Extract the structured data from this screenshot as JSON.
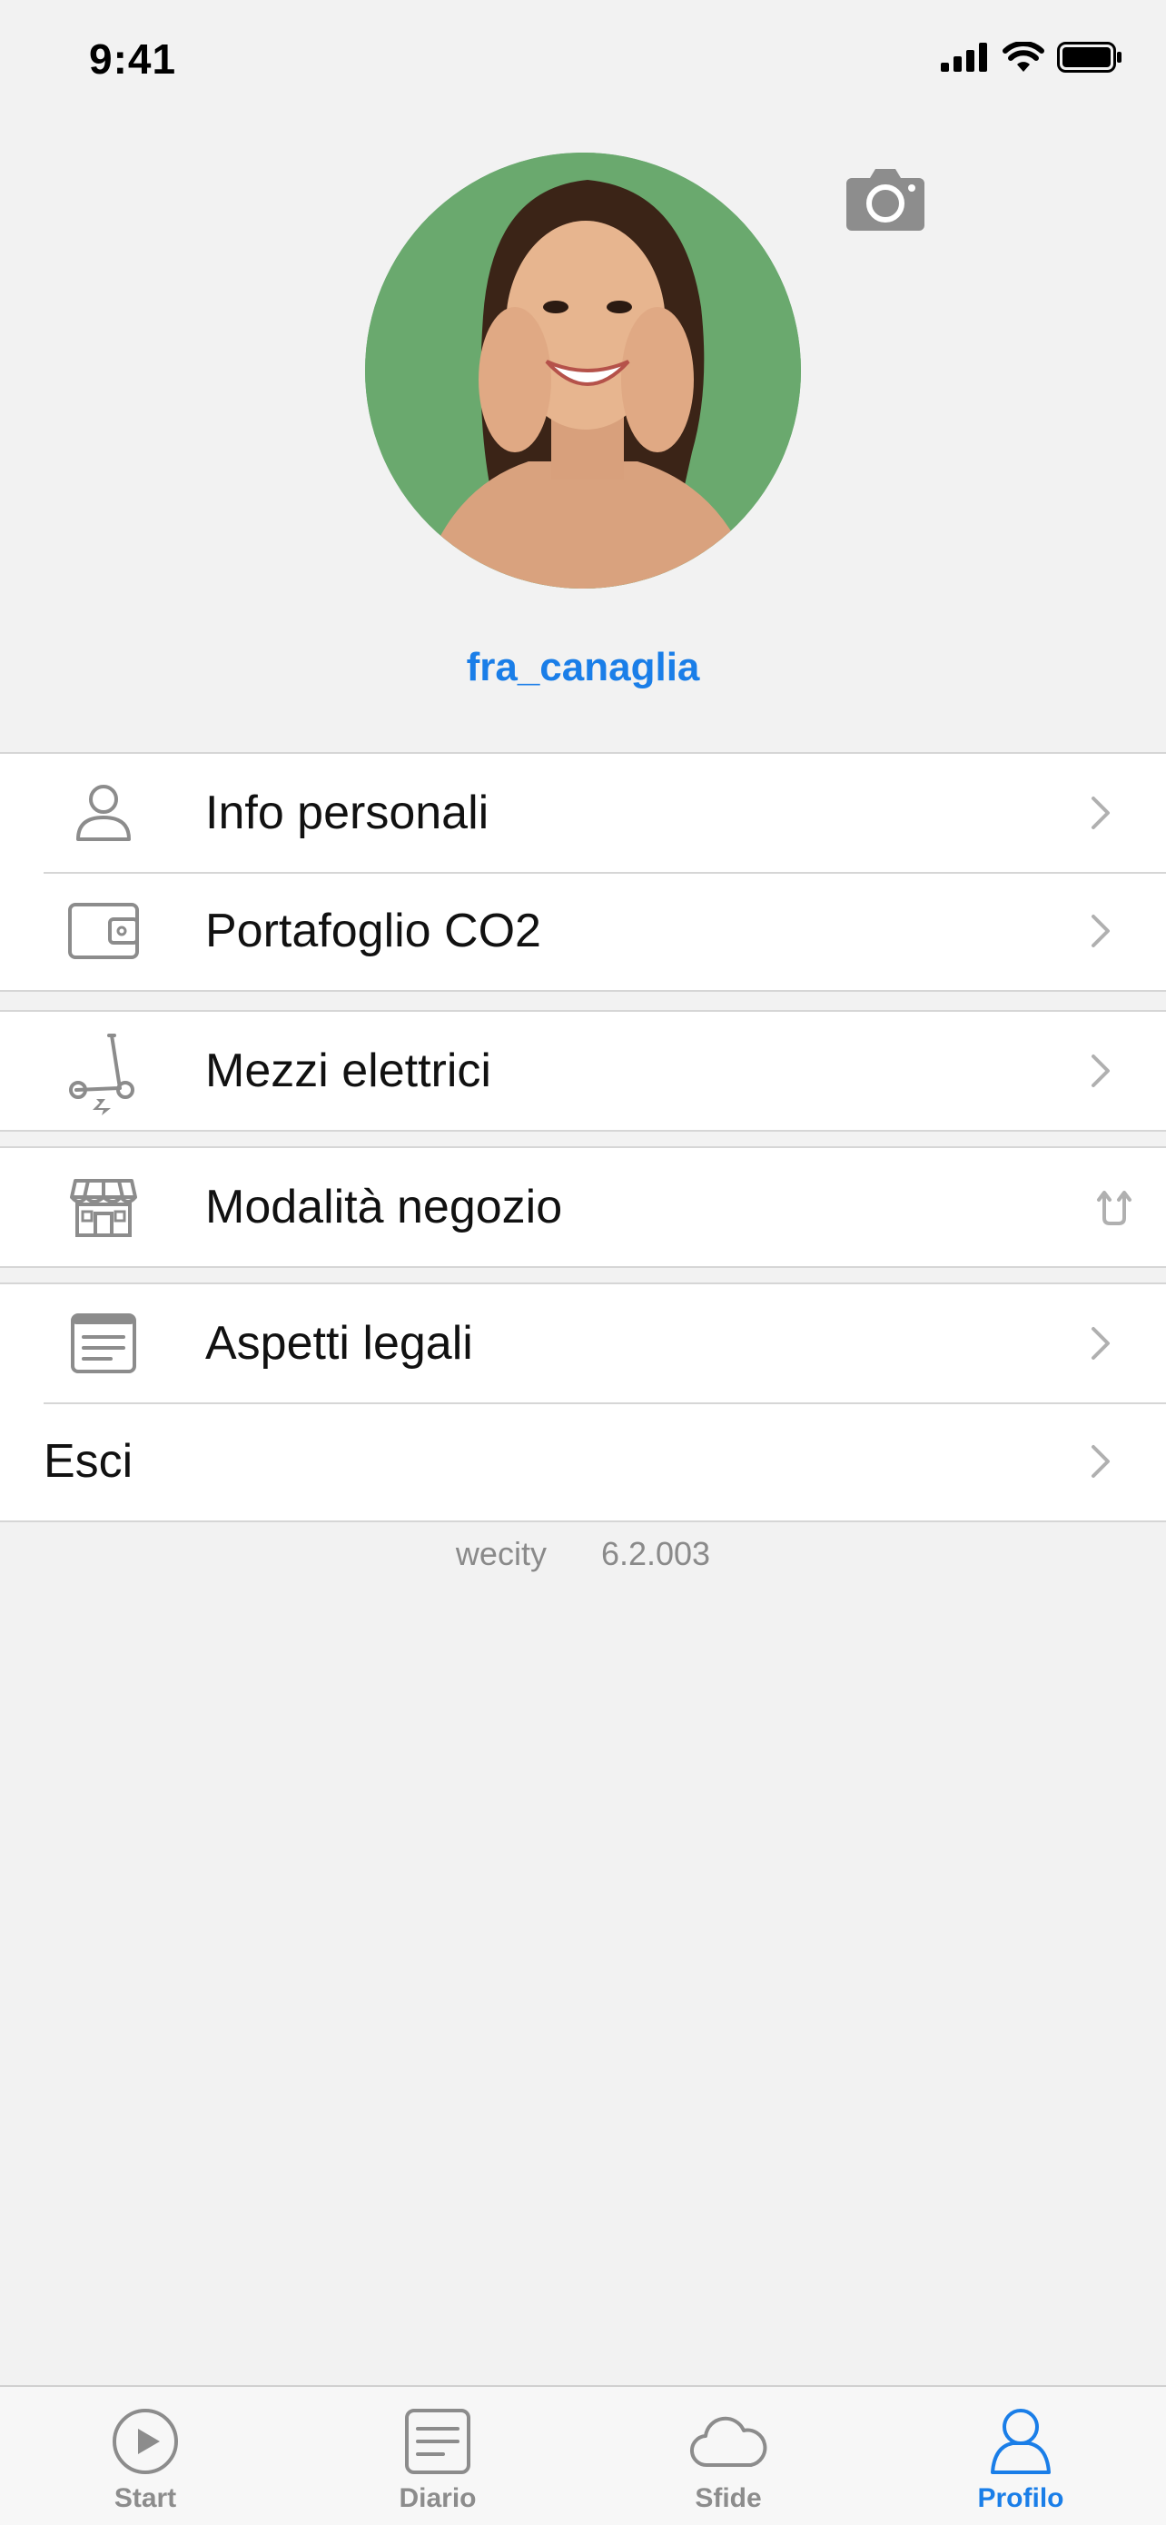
{
  "status_bar": {
    "time": "9:41",
    "icons": [
      "signal-icon",
      "wifi-icon",
      "battery-icon"
    ]
  },
  "profile": {
    "username": "fra_canaglia",
    "avatar": "profile-photo",
    "camera_icon": "camera-icon"
  },
  "menu": {
    "group1": [
      {
        "label": "Info personali",
        "icon": "person-icon"
      },
      {
        "label": "Portafoglio CO2",
        "icon": "wallet-icon"
      }
    ],
    "group2": [
      {
        "label": "Mezzi elettrici",
        "icon": "scooter-icon"
      }
    ],
    "group3": [
      {
        "label": "Modalità negozio",
        "icon": "store-icon",
        "accessory": "switch-arrows-icon"
      }
    ],
    "group4": [
      {
        "label": "Aspetti legali",
        "icon": "document-icon"
      },
      {
        "label": "Esci"
      }
    ]
  },
  "footer": {
    "app_name": "wecity",
    "version": "6.2.003"
  },
  "tab_bar": {
    "tabs": [
      {
        "label": "Start",
        "icon": "play-icon"
      },
      {
        "label": "Diario",
        "icon": "list-icon"
      },
      {
        "label": "Sfide",
        "icon": "cloud-icon"
      },
      {
        "label": "Profilo",
        "icon": "person-icon",
        "active": true
      }
    ]
  },
  "colors": {
    "accent": "#1a7ee8",
    "background": "#f2f2f2",
    "icon_gray": "#8c8c8c"
  }
}
